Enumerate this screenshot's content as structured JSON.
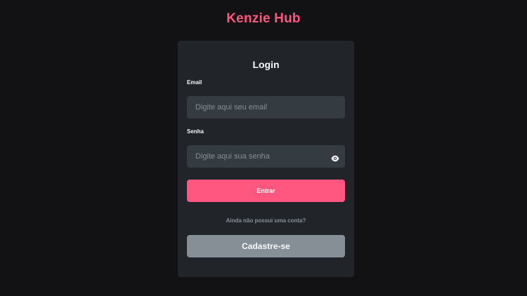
{
  "brand": {
    "title": "Kenzie Hub"
  },
  "login": {
    "title": "Login",
    "email_label": "Email",
    "email_placeholder": "Digite aqui seu email",
    "email_value": "",
    "password_label": "Senha",
    "password_placeholder": "Digite aqui sua senha",
    "password_value": "",
    "password_toggle_icon": "eye-icon",
    "submit_label": "Entrar",
    "signup_prompt": "Ainda não possui uma conta?",
    "signup_label": "Cadastre-se"
  },
  "colors": {
    "background": "#121214",
    "card": "#212529",
    "input": "#343b41",
    "primary": "#ff577f",
    "secondary": "#868e96",
    "text": "#f8f9fa"
  }
}
